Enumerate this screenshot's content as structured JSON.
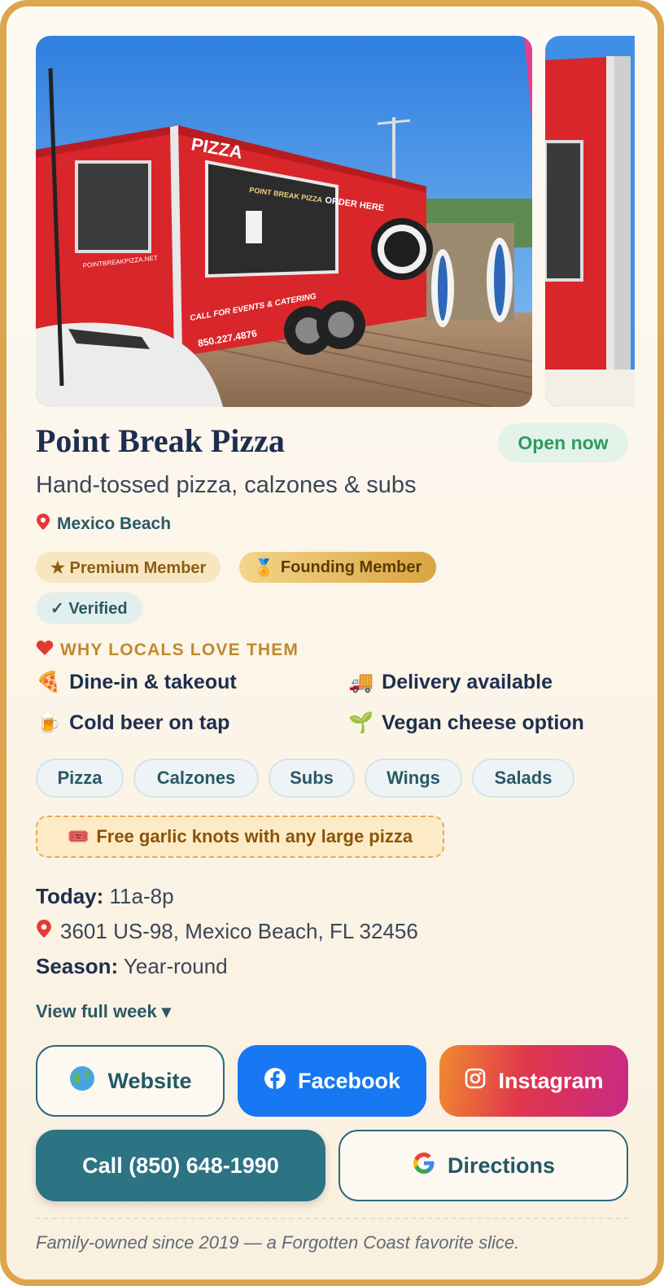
{
  "listing": {
    "name": "Point Break Pizza",
    "status": "Open now",
    "tagline": "Hand-tossed pizza, calzones & subs",
    "location": "Mexico Beach",
    "badges": {
      "premium": "★ Premium Member",
      "founding": "Founding Member",
      "verified": "✓ Verified"
    }
  },
  "photos": {
    "truck_text_1": "PIZZA",
    "truck_text_2": "POINT BREAK PIZZA",
    "truck_text_3": "ORDER HERE",
    "truck_text_4": "POINTBREAKPIZZA.NET",
    "truck_text_5": "CALL FOR EVENTS & CATERING",
    "truck_text_6": "850.227.4876"
  },
  "why": {
    "heading": "WHY LOCALS LOVE THEM",
    "features": [
      "Dine-in & takeout",
      "Delivery available",
      "Cold beer on tap",
      "Vegan cheese option"
    ]
  },
  "tags": [
    "Pizza",
    "Calzones",
    "Subs",
    "Wings",
    "Salads"
  ],
  "promo": "Free garlic knots with any large pizza",
  "info": {
    "today_label": "Today:",
    "today_value": "11a-8p",
    "address": "3601 US-98, Mexico Beach, FL 32456",
    "season_label": "Season:",
    "season_value": "Year-round",
    "view_week": "View full week ▾"
  },
  "buttons": {
    "website": "Website",
    "facebook": "Facebook",
    "instagram": "Instagram",
    "call": "Call (850) 648-1990",
    "directions": "Directions"
  },
  "footer": "Family-owned since 2019 — a Forgotten Coast favorite slice.",
  "colors": {
    "frame": "#dca54e",
    "title": "#1d2e4f",
    "teal": "#2c7384",
    "facebook": "#1877f2",
    "open_green": "#2e9a5f",
    "truck_red": "#d8262b"
  },
  "icons": {
    "location": "pin-icon",
    "heart": "heart-icon",
    "pizza": "pizza-icon",
    "delivery": "truck-icon",
    "beer": "beer-icon",
    "vegan": "seedling-icon",
    "ticket": "ticket-icon",
    "globe": "globe-icon",
    "facebook": "facebook-icon",
    "instagram": "instagram-icon",
    "google": "google-icon",
    "medal": "medal-icon"
  }
}
